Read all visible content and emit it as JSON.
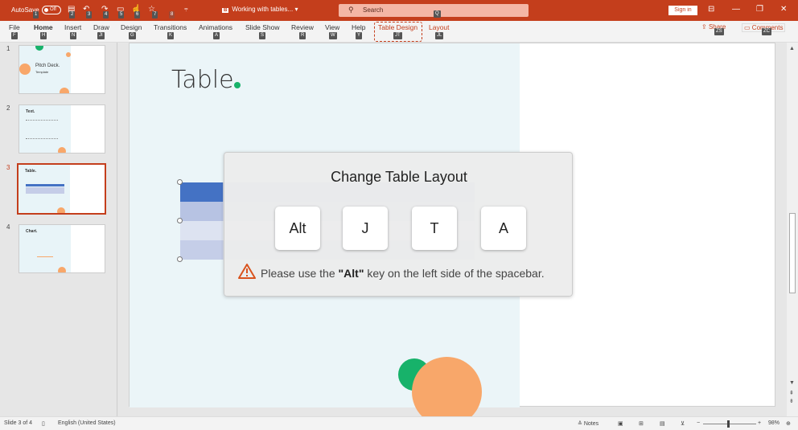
{
  "titlebar": {
    "autosave_label": "AutoSave",
    "autosave_state": "Off",
    "doc_badge": "B",
    "doc_title": "Working with tables...",
    "search_placeholder": "Search",
    "signin_label": "Sign in",
    "keytips": {
      "autosave": "1",
      "save": "2",
      "undo": "3",
      "redo": "4",
      "present": "5",
      "touch": "6",
      "favorites": "7",
      "more": "8",
      "search": "Q"
    }
  },
  "ribbon": {
    "tabs": [
      {
        "label": "File",
        "keytip": "F"
      },
      {
        "label": "Home",
        "keytip": "H"
      },
      {
        "label": "Insert",
        "keytip": "N"
      },
      {
        "label": "Draw",
        "keytip": "JI"
      },
      {
        "label": "Design",
        "keytip": "G"
      },
      {
        "label": "Transitions",
        "keytip": "K"
      },
      {
        "label": "Animations",
        "keytip": "A"
      },
      {
        "label": "Slide Show",
        "keytip": "S"
      },
      {
        "label": "Review",
        "keytip": "R"
      },
      {
        "label": "View",
        "keytip": "W"
      },
      {
        "label": "Help",
        "keytip": "Y"
      },
      {
        "label": "Table Design",
        "keytip": "JT"
      },
      {
        "label": "Layout",
        "keytip": "JL"
      }
    ],
    "share_label": "Share",
    "share_keytip": "ZS",
    "comments_label": "Comments",
    "comments_keytip": "ZC"
  },
  "slides": [
    {
      "number": "1",
      "title": "Pitch Deck.",
      "subtitle": "Template"
    },
    {
      "number": "2",
      "title": "Text."
    },
    {
      "number": "3",
      "title": "Table."
    },
    {
      "number": "4",
      "title": "Chart."
    }
  ],
  "slide": {
    "title": "Table"
  },
  "overlay": {
    "heading": "Change Table Layout",
    "keys": [
      "Alt",
      "J",
      "T",
      "A"
    ],
    "note_prefix": "Please use the ",
    "note_key": "\"Alt\"",
    "note_suffix": " key on the left side of the spacebar."
  },
  "statusbar": {
    "slide_info": "Slide 3 of 4",
    "language": "English (United States)",
    "notes_label": "Notes",
    "zoom": "98%"
  },
  "colors": {
    "brand": "#c43e1c",
    "accent_green": "#17b26a",
    "accent_orange": "#f8a76a",
    "table_header": "#4472c4"
  }
}
